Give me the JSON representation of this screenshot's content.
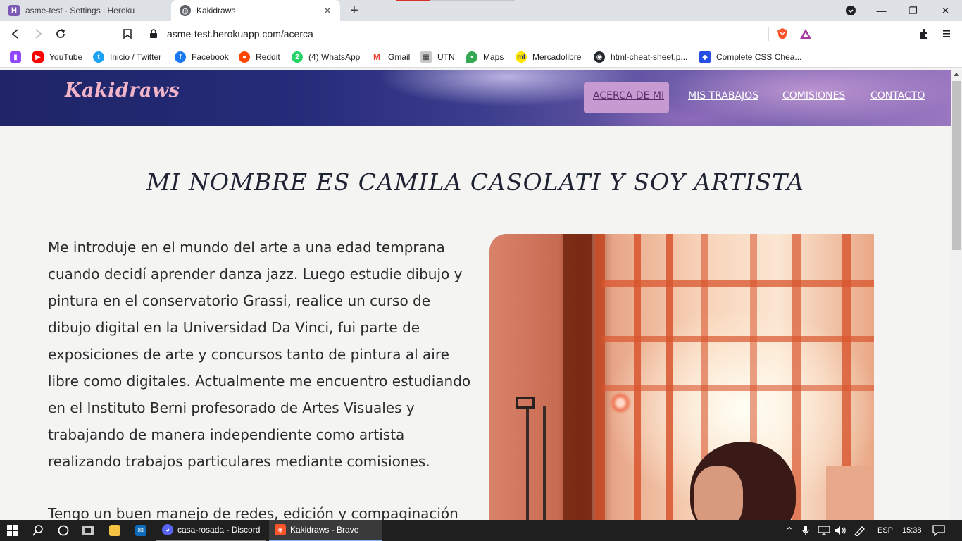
{
  "browser": {
    "tabs": [
      {
        "title": "asme-test · Settings | Heroku",
        "icon": "heroku-icon"
      },
      {
        "title": "Kakidraws",
        "icon": "globe-icon"
      }
    ],
    "url": "asme-test.herokuapp.com/acerca",
    "bookmarks": [
      {
        "label": "YouTube",
        "icon": "youtube-icon"
      },
      {
        "label": "Inicio / Twitter",
        "icon": "twitter-icon"
      },
      {
        "label": "Facebook",
        "icon": "facebook-icon"
      },
      {
        "label": "Reddit",
        "icon": "reddit-icon"
      },
      {
        "label": "(4) WhatsApp",
        "icon": "whatsapp-icon"
      },
      {
        "label": "Gmail",
        "icon": "gmail-icon"
      },
      {
        "label": "UTN",
        "icon": "utn-icon"
      },
      {
        "label": "Maps",
        "icon": "maps-icon"
      },
      {
        "label": "Mercadolibre",
        "icon": "mercadolibre-icon"
      },
      {
        "label": "html-cheat-sheet.p...",
        "icon": "github-icon"
      },
      {
        "label": "Complete CSS Chea...",
        "icon": "shield-icon"
      }
    ]
  },
  "site": {
    "logo": "Kakidraws",
    "nav": [
      "ACERCA DE MI",
      "MIS TRABAJOS",
      "COMISIONES",
      "CONTACTO"
    ],
    "active_nav": "ACERCA DE MI",
    "title": "MI NOMBRE ES CAMILA CASOLATI Y SOY ARTISTA",
    "para1": "Me introduje en el mundo del arte a una edad temprana cuando decidí aprender danza jazz. Luego estudie dibujo y pintura en el conservatorio Grassi, realice un curso de dibujo digital en la Universidad Da Vinci, fui parte de exposiciones de arte y concursos tanto de pintura al aire libre como digitales. Actualmente me encuentro estudiando en el Instituto Berni profesorado de Artes Visuales y trabajando de manera independiente como artista realizando trabajos particulares mediante comisiones.",
    "para2": "Tengo un buen manejo de redes, edición y compaginación de"
  },
  "taskbar": {
    "apps": [
      {
        "label": "casa-rosada - Discord",
        "icon": "discord-icon"
      },
      {
        "label": "Kakidraws - Brave",
        "icon": "brave-icon"
      }
    ],
    "lang": "ESP",
    "time": "15:38"
  },
  "colors": {
    "accent": "#c79ad1",
    "logo": "#f2b4c8"
  }
}
